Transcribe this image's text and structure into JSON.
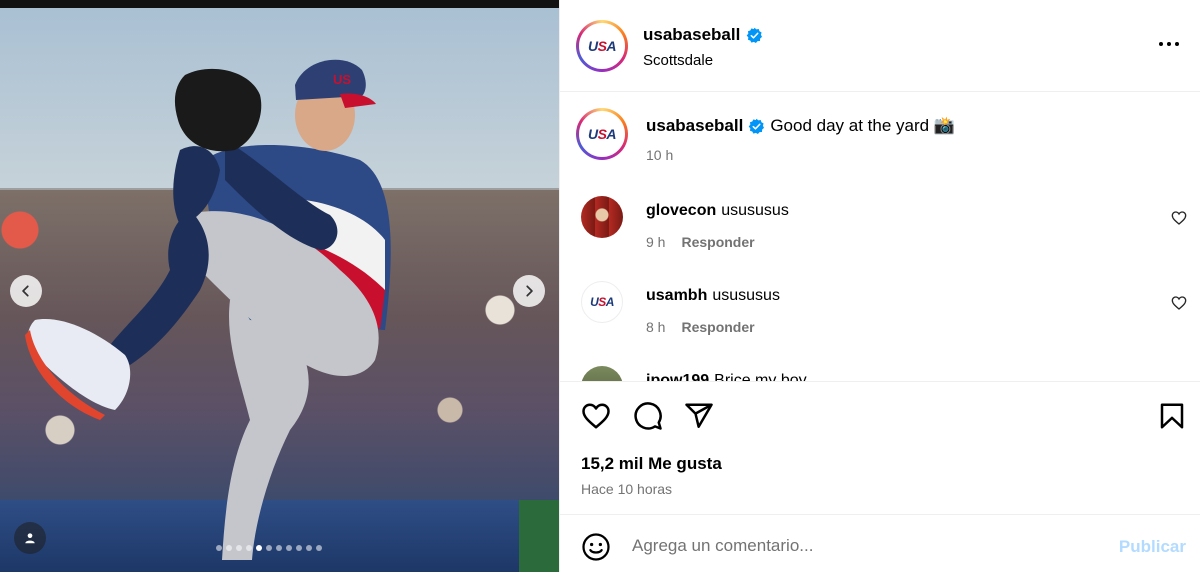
{
  "post": {
    "username": "usabaseball",
    "location": "Scottsdale",
    "avatar_logo": "USA",
    "verified": true
  },
  "caption": {
    "username": "usabaseball",
    "text": "Good day at the yard 📸",
    "time": "10 h"
  },
  "comments": [
    {
      "username": "glovecon",
      "text": "usususus",
      "time": "9 h",
      "reply_label": "Responder",
      "like_icon": "heart-outline-icon"
    },
    {
      "username": "usambh",
      "text": "usususus",
      "time": "8 h",
      "reply_label": "Responder",
      "like_icon": "heart-outline-icon"
    },
    {
      "username": "jpow199",
      "text": "Brice my boy",
      "time": "",
      "reply_label": "",
      "like_icon": "heart-outline-icon"
    }
  ],
  "actions": {
    "likes": "15,2 mil Me gusta",
    "ago": "Hace 10 horas",
    "icons": [
      "heart-icon",
      "comment-icon",
      "share-icon",
      "bookmark-icon"
    ]
  },
  "add_comment": {
    "placeholder": "Agrega un comentario...",
    "publish_label": "Publicar",
    "emoji_icon": "smiley-icon"
  },
  "carousel": {
    "slide_count": 11,
    "active_index": 4
  },
  "colors": {
    "accent_link": "#0095f6",
    "publish_disabled": "#b3dbff",
    "secondary_text": "#737373",
    "usa_blue": "#1d3b7a",
    "usa_red": "#c8102e"
  }
}
